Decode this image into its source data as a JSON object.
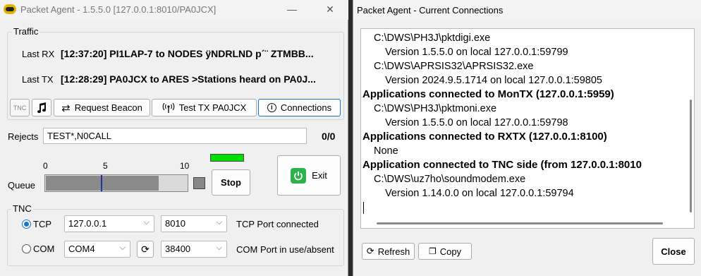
{
  "main_window": {
    "title": "Packet Agent - 1.5.5.0 [127.0.0.1:8010/PA0JCX]",
    "traffic": {
      "group_label": "Traffic",
      "last_rx_label": "Last RX",
      "last_rx_value": "[12:37:20] PI1LAP-7 to NODES ÿNDRLND p´¨ ZTMBB...",
      "last_tx_label": "Last TX",
      "last_tx_value": "[12:28:29] PA0JCX to ARES >Stations heard on PA0J..."
    },
    "toolbar": {
      "tnc_tab": "TNC",
      "request_beacon": "Request Beacon",
      "test_tx": "Test TX PA0JCX",
      "connections": "Connections"
    },
    "rejects": {
      "label": "Rejects",
      "value": "TEST*,N0CALL",
      "count": "0/0"
    },
    "queue": {
      "label": "Queue",
      "scale_min": "0",
      "scale_mid": "5",
      "scale_max": "10",
      "stop_label": "Stop",
      "exit_label": "Exit",
      "indicator_color": "#00e000"
    },
    "tnc": {
      "group_label": "TNC",
      "tcp_label": "TCP",
      "tcp_host": "127.0.0.1",
      "tcp_port": "8010",
      "tcp_status": "TCP Port connected",
      "com_label": "COM",
      "com_port": "COM4",
      "com_baud": "38400",
      "com_status": "COM Port in use/absent"
    }
  },
  "connections_window": {
    "title": "Packet Agent - Current Connections",
    "lines": [
      {
        "text": "C:\\DWS\\PH3J\\pktdigi.exe",
        "level": 1
      },
      {
        "text": "Version 1.5.5.0 on local 127.0.0.1:59799",
        "level": 2
      },
      {
        "text": "C:\\DWS\\APRSIS32\\APRSIS32.exe",
        "level": 1
      },
      {
        "text": "Version 2024.9.5.1714 on local 127.0.0.1:59805",
        "level": 2
      },
      {
        "text": "Applications connected to MonTX (127.0.0.1:5959)",
        "level": 0
      },
      {
        "text": "C:\\DWS\\PH3J\\pktmoni.exe",
        "level": 1
      },
      {
        "text": "Version 1.5.5.0 on local 127.0.0.1:59798",
        "level": 2
      },
      {
        "text": "Applications connected to RXTX (127.0.0.1:8100)",
        "level": 0
      },
      {
        "text": "None",
        "level": 1
      },
      {
        "text": "Application connected to TNC side (from 127.0.0.1:8010",
        "level": 0
      },
      {
        "text": "C:\\DWS\\uz7ho\\soundmodem.exe",
        "level": 1
      },
      {
        "text": "Version 1.14.0.0 on local 127.0.0.1:59794",
        "level": 2
      }
    ],
    "refresh_label": "Refresh",
    "copy_label": "Copy",
    "close_label": "Close"
  }
}
